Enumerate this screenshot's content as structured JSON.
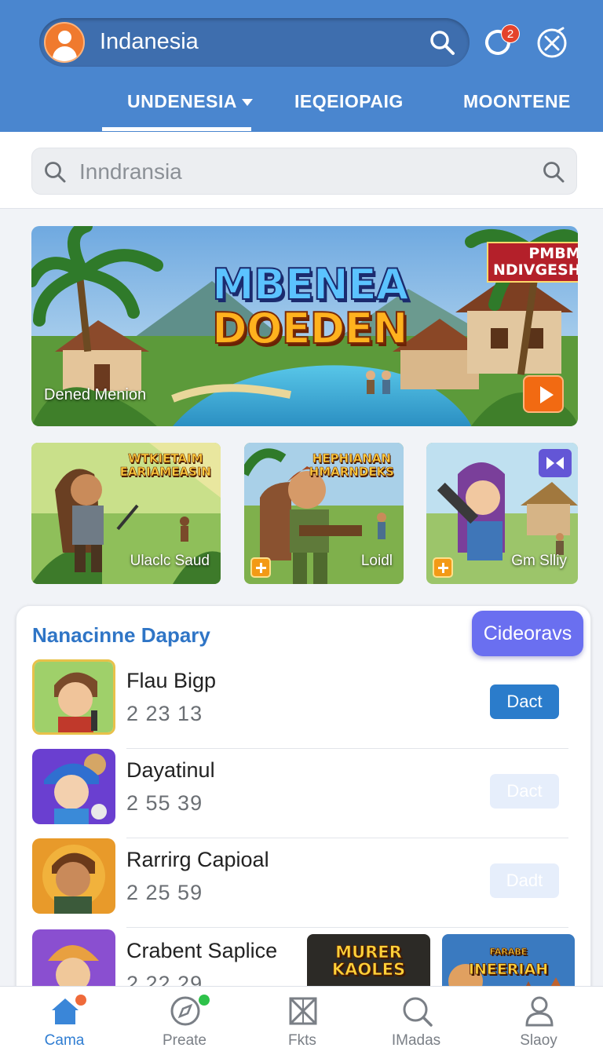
{
  "header": {
    "location_title": "Indanesia",
    "notification_count": "2",
    "tabs": [
      {
        "label": "UNDENESIA"
      },
      {
        "label": "IEQEIOPAIG"
      },
      {
        "label": "MOONTENE"
      }
    ],
    "accent_color": "#4a86cf"
  },
  "search": {
    "placeholder": "Inndransia"
  },
  "hero": {
    "title_line1": "MBENEA",
    "title_line2": "DOEDEN",
    "badge_line1": "PMBM",
    "badge_line2": "NDIVGESH",
    "caption": "Dened Menion"
  },
  "thumbnails": [
    {
      "title_line1": "WTKIETAIM",
      "title_line2": "EARIAMEASIN",
      "caption": "Ulaclc Saud"
    },
    {
      "title_line1": "HEPHIANAN",
      "title_line2": "HMARNDEKS",
      "caption": "Loidl"
    },
    {
      "title_line1": "",
      "title_line2": "",
      "caption": "Gm Slliy"
    }
  ],
  "list": {
    "title": "Nanacinne Dapary",
    "action_label": "Cideoravs",
    "rows": [
      {
        "name": "Flau Bigp",
        "meta": "2 23 13",
        "button": "Dact"
      },
      {
        "name": "Dayatinul",
        "meta": "2 55 39",
        "button": "Dact"
      },
      {
        "name": "Rarrirg Capioal",
        "meta": "2 25 59",
        "button": "Dadt"
      },
      {
        "name": "Crabent Saplice",
        "meta": "2 22 29"
      }
    ],
    "promos": [
      {
        "line1": "MURER",
        "line2": "KAOLES"
      },
      {
        "line1": "FARABE",
        "line2": "INEERIAH"
      }
    ]
  },
  "bottom_nav": [
    {
      "label": "Cama",
      "icon": "home-icon"
    },
    {
      "label": "Preate",
      "icon": "compass-icon"
    },
    {
      "label": "Fkts",
      "icon": "grid-x-icon"
    },
    {
      "label": "IMadas",
      "icon": "search-icon"
    },
    {
      "label": "Slaoy",
      "icon": "profile-icon"
    }
  ]
}
